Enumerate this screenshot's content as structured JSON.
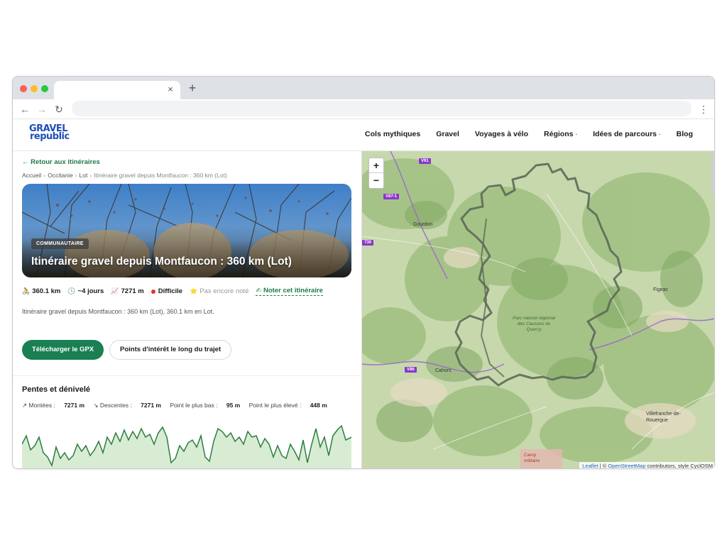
{
  "browser": {
    "tab_close": "×",
    "new_tab": "+",
    "back": "←",
    "forward": "→",
    "reload": "↻",
    "menu": "⋮"
  },
  "header": {
    "logo_line1": "GRAVEL",
    "logo_line2": "republic",
    "logo_color": "#1f4fb6",
    "nav": [
      {
        "label": "Cols mythiques",
        "dropdown": false
      },
      {
        "label": "Gravel",
        "dropdown": false
      },
      {
        "label": "Voyages à vélo",
        "dropdown": false
      },
      {
        "label": "Régions",
        "dropdown": true
      },
      {
        "label": "Idées de parcours",
        "dropdown": true
      },
      {
        "label": "Blog",
        "dropdown": false
      }
    ],
    "dropdown_marker": "·"
  },
  "page": {
    "back_link": "← Retour aux itinéraires",
    "breadcrumb": [
      "Accueil",
      "Occitanie",
      "Lot"
    ],
    "breadcrumb_current": "Itinéraire gravel depuis Montfaucon : 360 km (Lot)",
    "breadcrumb_sep": "›",
    "hero": {
      "badge": "COMMUNAUTAIRE",
      "title": "Itinéraire gravel depuis Montfaucon : 360 km (Lot)"
    },
    "stats": {
      "distance": "360.1 km",
      "duration": "~4 jours",
      "elevation": "7271 m",
      "difficulty": "Difficile",
      "rating": "Pas encore noté",
      "rate_link": "Noter cet itinéraire"
    },
    "icons": {
      "distance": "🚴",
      "duration": "🕓",
      "elevation": "📈",
      "rating": "⭐",
      "rate": "✍"
    },
    "description": "Itinéraire gravel depuis Montfaucon : 360 km (Lot), 360.1 km en Lot.",
    "buttons": {
      "gpx": "Télécharger le GPX",
      "poi": "Points d'intérêt le long du trajet"
    },
    "elevation": {
      "title": "Pentes et dénivelé",
      "ascent_label": "↗ Montées :",
      "ascent": "7271 m",
      "descent_label": "↘ Descentes :",
      "descent": "7271 m",
      "min_label": "Point le plus bas :",
      "min": "95 m",
      "max_label": "Point le plus élevé :",
      "max": "448 m"
    },
    "accent_color": "#1b7f54"
  },
  "map": {
    "zoom_in": "+",
    "zoom_out": "−",
    "places": [
      "Gourdon",
      "Figeac",
      "Cahors",
      "Villefranche-de-Rouergue",
      "Camp militaire"
    ],
    "park_label": "Parc naturel régional des Causses du Quercy",
    "roads": [
      "V91",
      "V87-1",
      "730",
      "V86"
    ],
    "attribution_leaflet": "Leaflet",
    "attribution_sep": "| ©",
    "attribution_osm": "OpenStreetMap",
    "attribution_rest": "contributors, style CyclOSM"
  }
}
